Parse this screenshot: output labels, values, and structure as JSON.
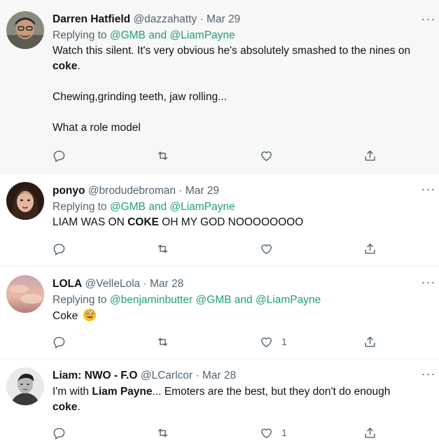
{
  "tweets": [
    {
      "name": "Darren Hatfield",
      "handle": "@dazzahatty",
      "dot": "·",
      "date": "Mar 29",
      "more": "···",
      "replying_prefix": "Replying to",
      "replying_to": "@GMB and @LiamPayne",
      "line1_text": "Watch this silent. It's very obvious he's absolutely smashed to the nines on",
      "line2_bold": "coke",
      "line2_rest": ".",
      "line3": "Chewing,grinding teeth, jaw rolling...",
      "line4": "What a role model",
      "like_count": ""
    },
    {
      "name": "ponyo",
      "handle": "@brodudebroman",
      "dot": "·",
      "date": "Mar 29",
      "more": "···",
      "replying_prefix": "Replying to",
      "replying_to": "@GMB and @LiamPayne",
      "text_pre": "LIAM WAS ON ",
      "text_bold": "COKE",
      "text_post": " OH MY GOD NOOOOOOOO",
      "like_count": ""
    },
    {
      "name": "LOLA",
      "handle": "@VelleLola",
      "dot": "·",
      "date": "Mar 28",
      "more": "···",
      "replying_prefix": "Replying to",
      "replying_to": "@benjaminbutter @GMB and @LiamPayne",
      "text": "Coke",
      "emoji": "zany-face-emoji",
      "like_count": "1"
    },
    {
      "name": "Liam: NWO - F.O",
      "handle": "@LCarlcor",
      "dot": "·",
      "date": "Mar 28",
      "more": "···",
      "line1_pre": "I'm with ",
      "line1_bold": "Liam Payne",
      "line1_post": "... Emoters are the best, but they don't do enough",
      "line2_bold": "coke",
      "line2_rest": ".",
      "like_count": "1"
    }
  ],
  "icons": {
    "reply": "reply-icon",
    "retweet": "retweet-icon",
    "like": "like-icon",
    "share": "share-icon"
  },
  "colors": {
    "mention": "#1da07c",
    "secondary": "#536471",
    "highlight_bg": "#f7f7f7"
  }
}
